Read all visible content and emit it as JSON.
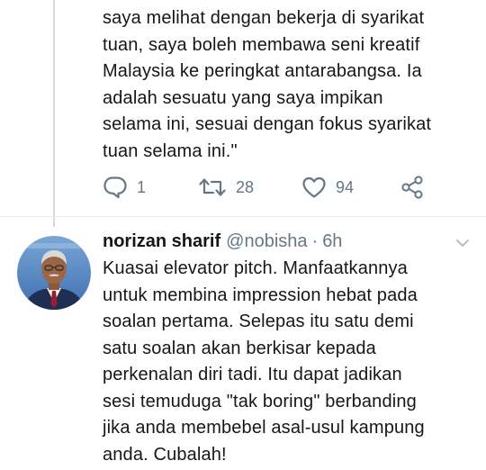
{
  "previous_tweet": {
    "text_lines": [
      "saya melihat dengan bekerja di syarikat",
      "tuan, saya boleh membawa seni kreatif",
      "Malaysia ke peringkat antarabangsa. Ia",
      "adalah sesuatu yang saya impikan",
      "selama ini, sesuai dengan fokus syarikat",
      "tuan selama ini.\""
    ],
    "actions": {
      "reply_icon": "reply-icon",
      "reply_count": "1",
      "retweet_icon": "retweet-icon",
      "retweet_count": "28",
      "like_icon": "heart-icon",
      "like_count": "94",
      "share_icon": "share-icon"
    }
  },
  "reply_tweet": {
    "author_name": "norizan sharif",
    "handle": "@nobisha",
    "separator": "·",
    "time": "6h",
    "text_lines": [
      "Kuasai elevator pitch. Manfaatkannya",
      "untuk membina impression hebat pada",
      "soalan pertama. Selepas itu satu demi",
      "satu soalan akan berkisar kepada",
      "perkenalan diri tadi. Itu dapat jadikan",
      "sesi temuduga \"tak boring\" berbanding",
      "jika anda membebel asal-usul kampung",
      "anda. Cubalah!"
    ]
  },
  "colors": {
    "text": "#14171a",
    "muted": "#657786",
    "divider": "#e6ecf0",
    "thread_line": "#cfd9de"
  }
}
